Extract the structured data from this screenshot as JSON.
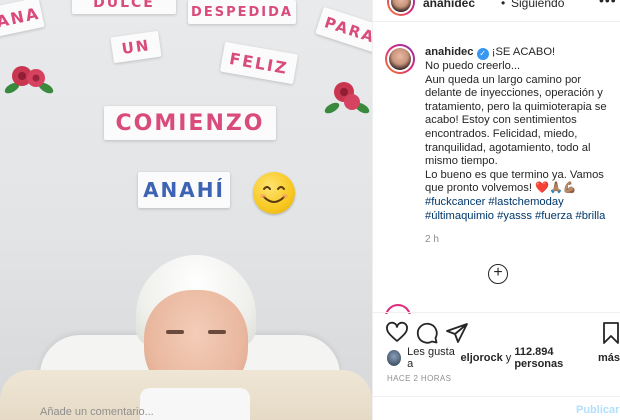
{
  "photo": {
    "words": {
      "vana": "ana",
      "dulce": "DULCE",
      "despedida": "DESPEDIDA",
      "para": "Para",
      "un": "UN",
      "feliz": "FELIZ",
      "comienzo": "COMIENZO",
      "anahi": "ANAHÍ"
    },
    "emoji_icon": "smiling-face-emoji"
  },
  "header": {
    "username": "anahidec",
    "separator": "•",
    "follow_status": "Siguiendo",
    "more_icon": "more-options-icon"
  },
  "caption": {
    "username": "anahidec",
    "lines": [
      "¡SE ACABO!",
      "No puedo creerlo...",
      "Aun queda un largo camino por",
      "delante de inyecciones, operación y",
      "tratamiento, pero la quimioterapia se",
      "acabo! Estoy con sentimientos",
      "encontrados. Felicidad, miedo,",
      "tranquilidad, agotamiento, todo al",
      "mismo tiempo.",
      "Lo bueno es que termino ya. Vamos",
      "que pronto volvemos! ❤️🙏🏽💪🏽"
    ],
    "hashtags": [
      "#fuckcancer #lastchemoday",
      "#últimaquimio #yasss #fuerza #brilla"
    ],
    "time": "2 h"
  },
  "actions": {
    "like_icon": "heart-icon",
    "comment_icon": "comment-icon",
    "share_icon": "send-icon",
    "save_icon": "bookmark-icon",
    "load_more_icon": "plus-circle-icon"
  },
  "likes": {
    "prefix": "Les gusta a",
    "user": "eljorock",
    "connector": "y",
    "count": "112.894 personas",
    "suffix": "más"
  },
  "posted": "HACE 2 HORAS",
  "comment": {
    "placeholder": "Añade un comentario...",
    "publish": "Publicar"
  },
  "colors": {
    "accent_link": "#00376b",
    "verified": "#3897f0",
    "publish_disabled": "#b2dffc",
    "pink_letters": "#d94b7c",
    "blue_letters": "#3d63b4"
  }
}
